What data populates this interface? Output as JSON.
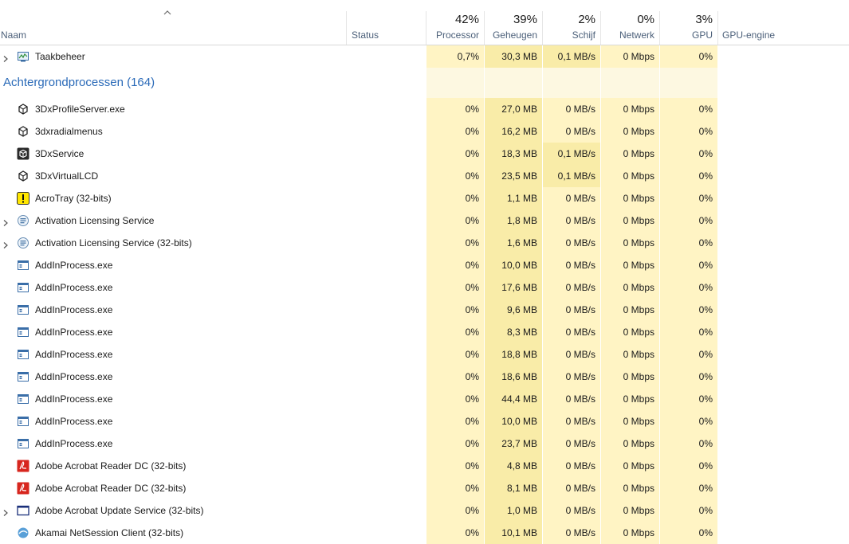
{
  "header": {
    "name_label": "Naam",
    "status_label": "Status",
    "gpu_engine_label": "GPU-engine",
    "metrics": [
      {
        "pct": "42%",
        "label": "Processor"
      },
      {
        "pct": "39%",
        "label": "Geheugen"
      },
      {
        "pct": "2%",
        "label": "Schijf"
      },
      {
        "pct": "0%",
        "label": "Netwerk"
      },
      {
        "pct": "3%",
        "label": "GPU"
      }
    ]
  },
  "colors": {
    "cell_light": "#fff4c4",
    "cell_medium": "#f9eca8",
    "group_empty": "#fdf8e1",
    "group_title": "#2a6ab8",
    "header_label": "#4c607a"
  },
  "apps": [
    {
      "name": "Taakbeheer",
      "icon": "task-manager-icon",
      "expandable": true,
      "cpu": "0,7%",
      "mem": "30,3 MB",
      "disk": "0,1 MB/s",
      "net": "0 Mbps",
      "gpu": "0%"
    }
  ],
  "background_group": {
    "title": "Achtergrondprocessen (164)"
  },
  "processes": [
    {
      "name": "3DxProfileServer.exe",
      "icon": "3dx-icon",
      "expandable": false,
      "cpu": "0%",
      "mem": "27,0 MB",
      "disk": "0 MB/s",
      "net": "0 Mbps",
      "gpu": "0%"
    },
    {
      "name": "3dxradialmenus",
      "icon": "3dx-icon",
      "expandable": false,
      "cpu": "0%",
      "mem": "16,2 MB",
      "disk": "0 MB/s",
      "net": "0 Mbps",
      "gpu": "0%"
    },
    {
      "name": "3DxService",
      "icon": "3dx-service-icon",
      "expandable": false,
      "cpu": "0%",
      "mem": "18,3 MB",
      "disk": "0,1 MB/s",
      "net": "0 Mbps",
      "gpu": "0%"
    },
    {
      "name": "3DxVirtualLCD",
      "icon": "3dx-icon",
      "expandable": false,
      "cpu": "0%",
      "mem": "23,5 MB",
      "disk": "0,1 MB/s",
      "net": "0 Mbps",
      "gpu": "0%"
    },
    {
      "name": "AcroTray (32-bits)",
      "icon": "acrotray-icon",
      "expandable": false,
      "cpu": "0%",
      "mem": "1,1 MB",
      "disk": "0 MB/s",
      "net": "0 Mbps",
      "gpu": "0%"
    },
    {
      "name": "Activation Licensing Service",
      "icon": "service-icon",
      "expandable": true,
      "cpu": "0%",
      "mem": "1,8 MB",
      "disk": "0 MB/s",
      "net": "0 Mbps",
      "gpu": "0%"
    },
    {
      "name": "Activation Licensing Service (32-bits)",
      "icon": "service-icon",
      "expandable": true,
      "cpu": "0%",
      "mem": "1,6 MB",
      "disk": "0 MB/s",
      "net": "0 Mbps",
      "gpu": "0%"
    },
    {
      "name": "AddInProcess.exe",
      "icon": "app-window-icon",
      "expandable": false,
      "cpu": "0%",
      "mem": "10,0 MB",
      "disk": "0 MB/s",
      "net": "0 Mbps",
      "gpu": "0%"
    },
    {
      "name": "AddInProcess.exe",
      "icon": "app-window-icon",
      "expandable": false,
      "cpu": "0%",
      "mem": "17,6 MB",
      "disk": "0 MB/s",
      "net": "0 Mbps",
      "gpu": "0%"
    },
    {
      "name": "AddInProcess.exe",
      "icon": "app-window-icon",
      "expandable": false,
      "cpu": "0%",
      "mem": "9,6 MB",
      "disk": "0 MB/s",
      "net": "0 Mbps",
      "gpu": "0%"
    },
    {
      "name": "AddInProcess.exe",
      "icon": "app-window-icon",
      "expandable": false,
      "cpu": "0%",
      "mem": "8,3 MB",
      "disk": "0 MB/s",
      "net": "0 Mbps",
      "gpu": "0%"
    },
    {
      "name": "AddInProcess.exe",
      "icon": "app-window-icon",
      "expandable": false,
      "cpu": "0%",
      "mem": "18,8 MB",
      "disk": "0 MB/s",
      "net": "0 Mbps",
      "gpu": "0%"
    },
    {
      "name": "AddInProcess.exe",
      "icon": "app-window-icon",
      "expandable": false,
      "cpu": "0%",
      "mem": "18,6 MB",
      "disk": "0 MB/s",
      "net": "0 Mbps",
      "gpu": "0%"
    },
    {
      "name": "AddInProcess.exe",
      "icon": "app-window-icon",
      "expandable": false,
      "cpu": "0%",
      "mem": "44,4 MB",
      "disk": "0 MB/s",
      "net": "0 Mbps",
      "gpu": "0%"
    },
    {
      "name": "AddInProcess.exe",
      "icon": "app-window-icon",
      "expandable": false,
      "cpu": "0%",
      "mem": "10,0 MB",
      "disk": "0 MB/s",
      "net": "0 Mbps",
      "gpu": "0%"
    },
    {
      "name": "AddInProcess.exe",
      "icon": "app-window-icon",
      "expandable": false,
      "cpu": "0%",
      "mem": "23,7 MB",
      "disk": "0 MB/s",
      "net": "0 Mbps",
      "gpu": "0%"
    },
    {
      "name": "Adobe Acrobat Reader DC (32-bits)",
      "icon": "acrobat-reader-icon",
      "expandable": false,
      "cpu": "0%",
      "mem": "4,8 MB",
      "disk": "0 MB/s",
      "net": "0 Mbps",
      "gpu": "0%"
    },
    {
      "name": "Adobe Acrobat Reader DC (32-bits)",
      "icon": "acrobat-reader-icon",
      "expandable": false,
      "cpu": "0%",
      "mem": "8,1 MB",
      "disk": "0 MB/s",
      "net": "0 Mbps",
      "gpu": "0%"
    },
    {
      "name": "Adobe Acrobat Update Service (32-bits)",
      "icon": "window-frame-icon",
      "expandable": true,
      "cpu": "0%",
      "mem": "1,0 MB",
      "disk": "0 MB/s",
      "net": "0 Mbps",
      "gpu": "0%"
    },
    {
      "name": "Akamai NetSession Client (32-bits)",
      "icon": "akamai-icon",
      "expandable": false,
      "cpu": "0%",
      "mem": "10,1 MB",
      "disk": "0 MB/s",
      "net": "0 Mbps",
      "gpu": "0%"
    }
  ]
}
